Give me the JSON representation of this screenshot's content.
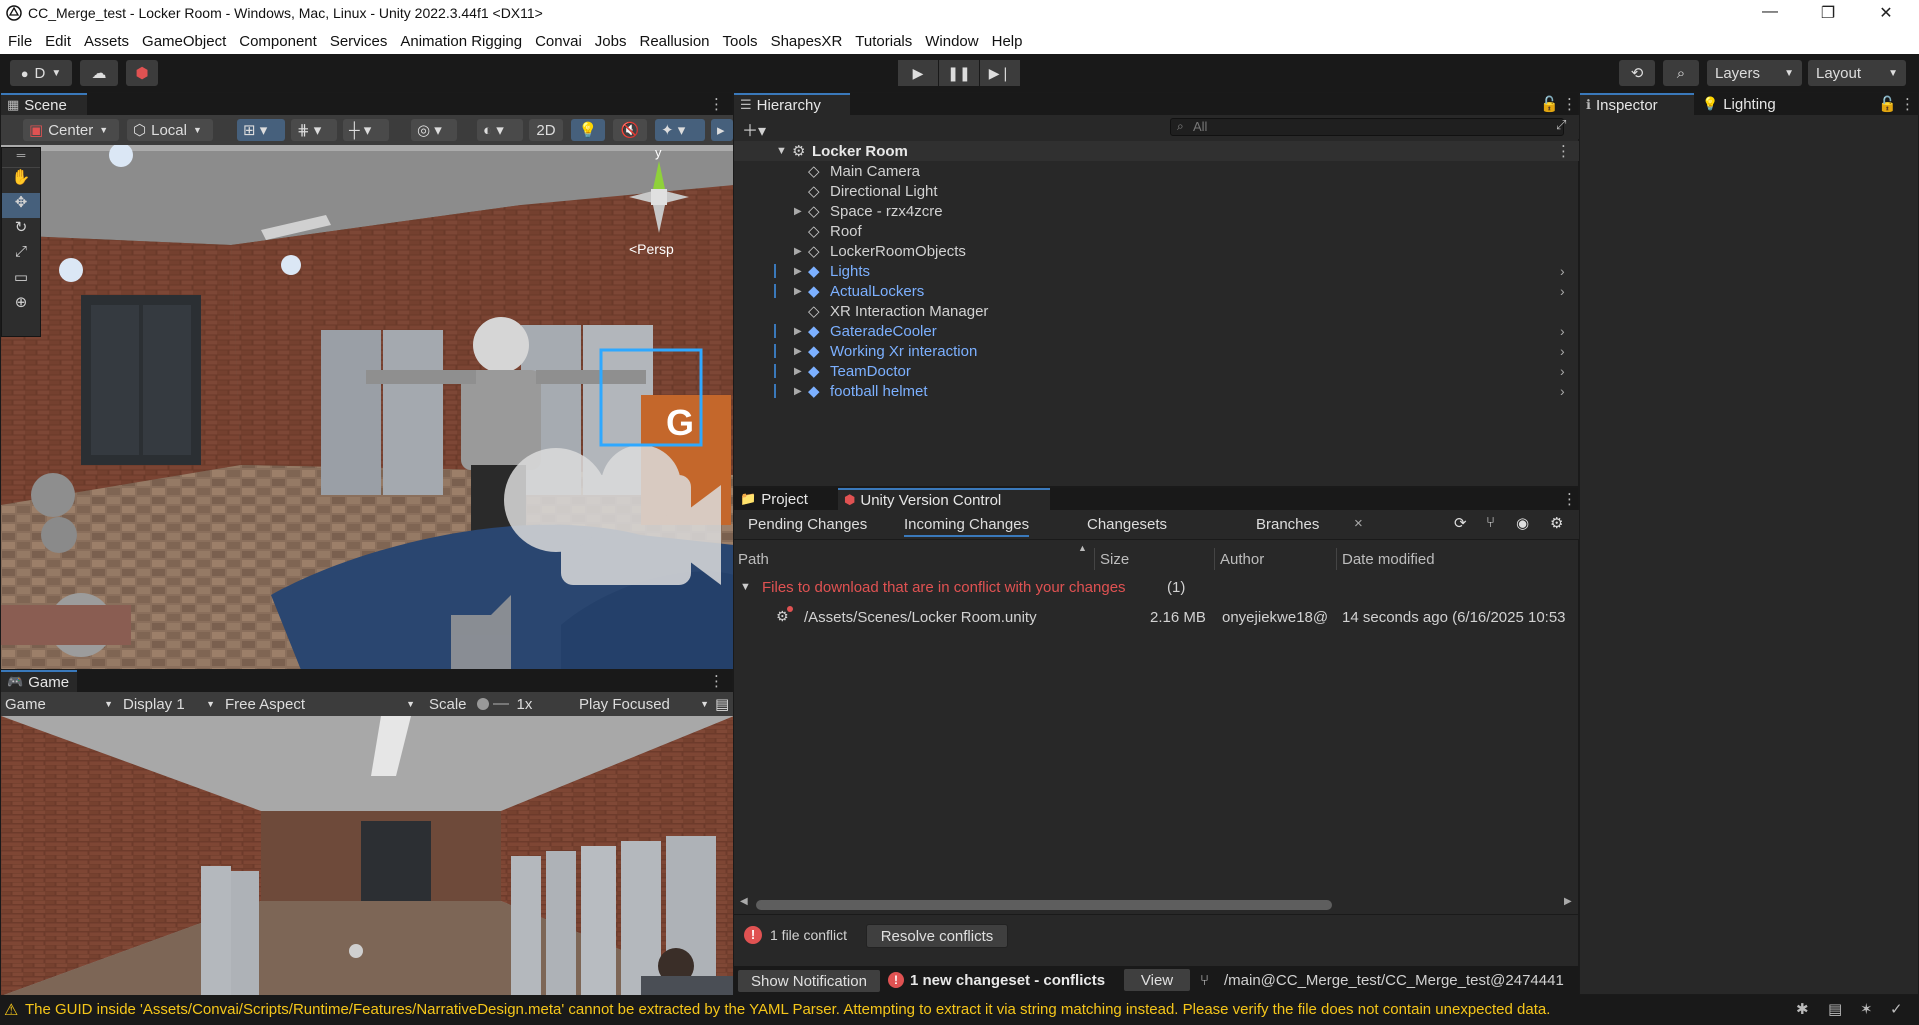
{
  "window": {
    "title": "CC_Merge_test - Locker Room - Windows, Mac, Linux - Unity 2022.3.44f1 <DX11>",
    "min_glyph": "—",
    "restore_glyph": "❐",
    "close_glyph": "✕"
  },
  "menu": [
    "File",
    "Edit",
    "Assets",
    "GameObject",
    "Component",
    "Services",
    "Animation Rigging",
    "Convai",
    "Jobs",
    "Reallusion",
    "Tools",
    "ShapesXR",
    "Tutorials",
    "Window",
    "Help"
  ],
  "toolbar": {
    "account_label": "D",
    "layers_label": "Layers",
    "layout_label": "Layout"
  },
  "scene": {
    "tab_label": "Scene",
    "pivot_label": "Center",
    "space_label": "Local",
    "mode_2d_label": "2D",
    "persp_label": "<Persp",
    "gizmo_y_label": "y"
  },
  "game": {
    "tab_label": "Game",
    "view_select": "Game",
    "display_select": "Display 1",
    "aspect_select": "Free Aspect",
    "scale_label": "Scale",
    "scale_value": "1x",
    "play_mode_select": "Play Focused"
  },
  "hierarchy": {
    "tab_label": "Hierarchy",
    "search_placeholder": "All",
    "scene_name": "Locker Room",
    "items": [
      {
        "label": "Main Camera",
        "prefab": false,
        "expandable": false
      },
      {
        "label": "Directional Light",
        "prefab": false,
        "expandable": false
      },
      {
        "label": "Space - rzx4zcre",
        "prefab": false,
        "expandable": true
      },
      {
        "label": "Roof",
        "prefab": false,
        "expandable": false
      },
      {
        "label": "LockerRoomObjects",
        "prefab": false,
        "expandable": true
      },
      {
        "label": "Lights",
        "prefab": true,
        "expandable": true
      },
      {
        "label": "ActualLockers",
        "prefab": true,
        "expandable": true
      },
      {
        "label": "XR Interaction Manager",
        "prefab": false,
        "expandable": false
      },
      {
        "label": "GateradeCooler",
        "prefab": true,
        "expandable": true
      },
      {
        "label": "Working Xr interaction",
        "prefab": true,
        "expandable": true
      },
      {
        "label": "TeamDoctor",
        "prefab": true,
        "expandable": true
      },
      {
        "label": "football helmet",
        "prefab": true,
        "expandable": true
      }
    ]
  },
  "version_control": {
    "tab_project": "Project",
    "tab_uvc": "Unity Version Control",
    "subtabs": [
      "Pending Changes",
      "Incoming Changes",
      "Changesets",
      "Branches"
    ],
    "close_glyph": "×",
    "columns": {
      "path": "Path",
      "size": "Size",
      "author": "Author",
      "date": "Date modified"
    },
    "group_label": "Files to download that are in conflict with your changes",
    "group_count": "(1)",
    "file": {
      "path": "/Assets/Scenes/Locker Room.unity",
      "size": "2.16 MB",
      "author": "onyejiekwe18@",
      "date": "14 seconds ago (6/16/2025 10:53"
    },
    "conflict_summary": "1 file conflict",
    "resolve_button": "Resolve conflicts",
    "show_notification_button": "Show Notification",
    "changeset_notice": "1 new changeset - conflicts",
    "view_button": "View",
    "branch_path": "/main@CC_Merge_test/CC_Merge_test@2474441"
  },
  "inspector": {
    "tab_inspector": "Inspector",
    "tab_lighting": "Lighting"
  },
  "status_bar": {
    "message": "The GUID inside 'Assets/Convai/Scripts/Runtime/Features/NarrativeDesign.meta' cannot be extracted by the YAML Parser. Attempting to extract it via string matching instead. Please verify the file does not contain unexpected data."
  },
  "colors": {
    "accent_blue": "#3a79bb",
    "prefab_blue": "#7cb0ff",
    "conflict_red": "#e05252",
    "warning_yellow": "#f5c61a"
  }
}
